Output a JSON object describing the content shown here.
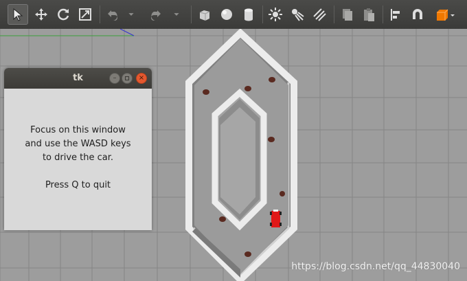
{
  "toolbar": {
    "tools": [
      {
        "icon": "select-arrow-icon",
        "active": true
      },
      {
        "icon": "translate-icon"
      },
      {
        "icon": "rotate-icon"
      },
      {
        "icon": "scale-icon"
      },
      {
        "icon": "undo-icon"
      },
      {
        "icon": "undo-dropdown-icon"
      },
      {
        "icon": "redo-icon"
      },
      {
        "icon": "redo-dropdown-icon"
      },
      {
        "icon": "box-shape-icon"
      },
      {
        "icon": "sphere-shape-icon"
      },
      {
        "icon": "cylinder-shape-icon"
      },
      {
        "icon": "point-light-icon"
      },
      {
        "icon": "spot-light-icon"
      },
      {
        "icon": "directional-light-icon"
      },
      {
        "icon": "copy-icon"
      },
      {
        "icon": "paste-icon"
      },
      {
        "icon": "align-icon"
      },
      {
        "icon": "snap-magnet-icon"
      },
      {
        "icon": "change-view-icon"
      }
    ]
  },
  "tk_window": {
    "title": "tk",
    "buttons": {
      "minimize": "minimize-icon",
      "maximize": "maximize-icon",
      "close": "close-icon"
    },
    "lines": [
      "Focus on this window",
      "and use the WASD keys",
      "to drive the car.",
      "",
      "Press Q to quit"
    ]
  },
  "watermark": "https://blog.csdn.net/qq_44830040",
  "colors": {
    "toolbar_bg": "#3f3f3d",
    "ground": "#9c9c9c",
    "grid": "#858585",
    "wall": "#ececec",
    "car": "#e01818",
    "obstacle": "#5a2a20",
    "accent_orange": "#f07800"
  }
}
